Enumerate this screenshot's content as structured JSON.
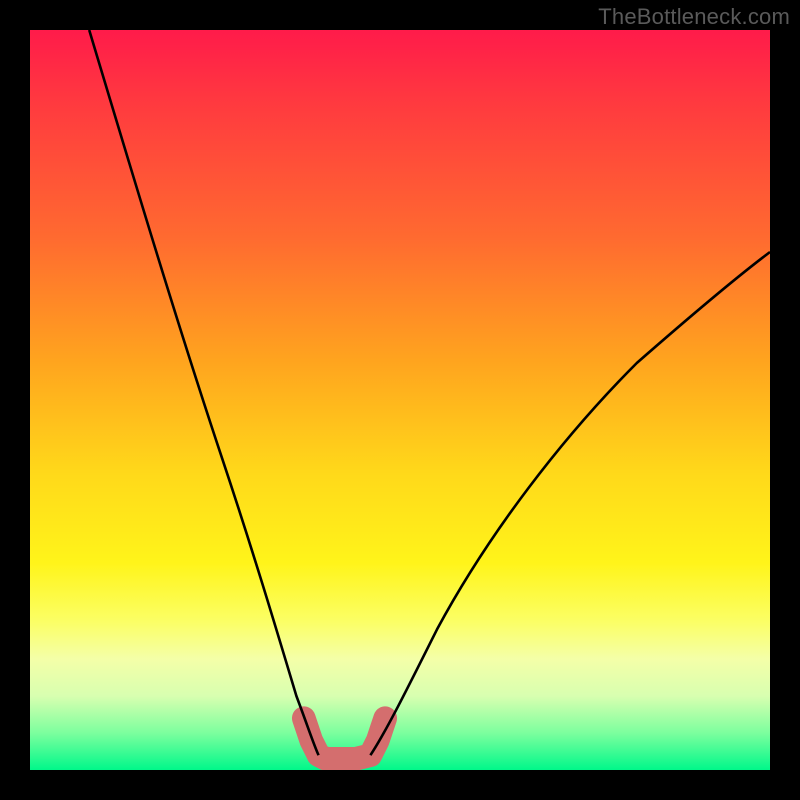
{
  "watermark": "TheBottleneck.com",
  "chart_data": {
    "type": "line",
    "title": "",
    "xlabel": "",
    "ylabel": "",
    "xlim": [
      0,
      100
    ],
    "ylim": [
      0,
      100
    ],
    "gradient_colors_top_to_bottom": [
      "#ff1b4a",
      "#ff6a30",
      "#ffd91a",
      "#fbff66",
      "#00f78a"
    ],
    "series": [
      {
        "name": "left-curve",
        "x": [
          8,
          12,
          16,
          20,
          24,
          28,
          32,
          35,
          37,
          38,
          39
        ],
        "y": [
          100,
          88,
          74,
          60,
          46,
          32,
          20,
          10,
          5,
          3,
          2
        ],
        "stroke": "#000000",
        "stroke_width": 2
      },
      {
        "name": "right-curve",
        "x": [
          46,
          48,
          52,
          58,
          66,
          76,
          88,
          100
        ],
        "y": [
          2,
          4,
          10,
          20,
          34,
          48,
          60,
          70
        ],
        "stroke": "#000000",
        "stroke_width": 2
      },
      {
        "name": "bottom-marker",
        "x": [
          37,
          38,
          39,
          40,
          42,
          44,
          46,
          47,
          48
        ],
        "y": [
          7,
          4,
          2,
          1.5,
          1.5,
          1.5,
          2,
          4,
          7
        ],
        "stroke": "#d86a6a",
        "stroke_width": 14
      }
    ],
    "marker_valley_x_range": [
      37,
      48
    ],
    "marker_valley_y": 1.5
  }
}
